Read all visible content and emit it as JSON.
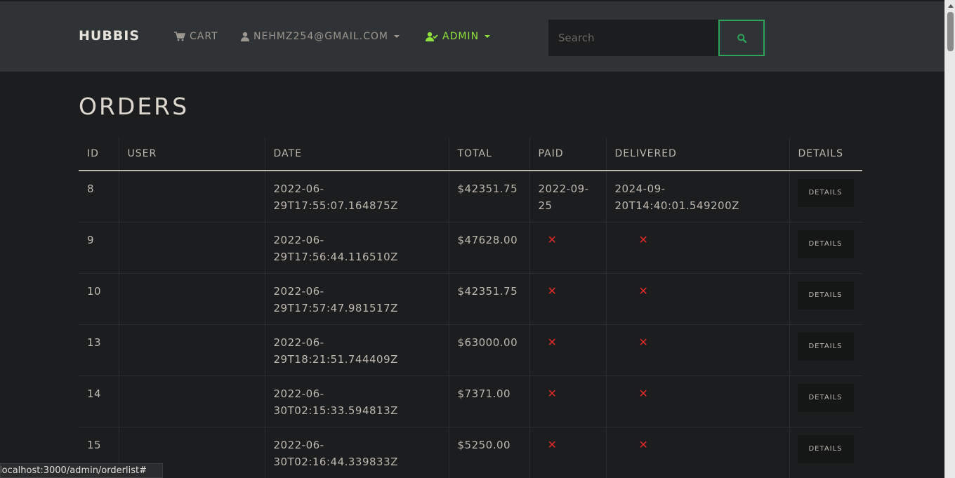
{
  "navbar": {
    "brand": "HUBBIS",
    "cart_label": "CART",
    "user_label": "NEHMZ254@GMAIL.COM",
    "admin_label": "ADMIN",
    "search_placeholder": "Search"
  },
  "page_title": "ORDERS",
  "table": {
    "headers": [
      "ID",
      "USER",
      "DATE",
      "TOTAL",
      "PAID",
      "DELIVERED",
      "DETAILS"
    ],
    "rows": [
      {
        "id": "8",
        "user": "",
        "date_l1": "2022-06-",
        "date_l2": "29T17:55:07.164875Z",
        "total": "$42351.75",
        "paid_l1": "2022-09-",
        "paid_l2": "25",
        "delivered_l1": "2024-09-",
        "delivered_l2": "20T14:40:01.549200Z",
        "details": "DETAILS"
      },
      {
        "id": "9",
        "user": "",
        "date_l1": "2022-06-",
        "date_l2": "29T17:56:44.116510Z",
        "total": "$47628.00",
        "paid": "✕",
        "delivered": "✕",
        "details": "DETAILS"
      },
      {
        "id": "10",
        "user": "",
        "date_l1": "2022-06-",
        "date_l2": "29T17:57:47.981517Z",
        "total": "$42351.75",
        "paid": "✕",
        "delivered": "✕",
        "details": "DETAILS"
      },
      {
        "id": "13",
        "user": "",
        "date_l1": "2022-06-",
        "date_l2": "29T18:21:51.744409Z",
        "total": "$63000.00",
        "paid": "✕",
        "delivered": "✕",
        "details": "DETAILS"
      },
      {
        "id": "14",
        "user": "",
        "date_l1": "2022-06-",
        "date_l2": "30T02:15:33.594813Z",
        "total": "$7371.00",
        "paid": "✕",
        "delivered": "✕",
        "details": "DETAILS"
      },
      {
        "id": "15",
        "user": "",
        "date_l1": "2022-06-",
        "date_l2": "30T02:16:44.339833Z",
        "total": "$5250.00",
        "paid": "✕",
        "delivered": "✕",
        "details": "DETAILS"
      }
    ]
  },
  "status_url": "localhost:3000/admin/orderlist#",
  "colors": {
    "accent_admin": "#8fe23b",
    "search_border": "#2ea35a",
    "not_done_mark": "#e02a2a"
  },
  "icons": {
    "cart": "cart-icon",
    "user": "user-icon",
    "admin": "user-check-icon",
    "search": "search-icon",
    "not_done": "close-icon"
  }
}
